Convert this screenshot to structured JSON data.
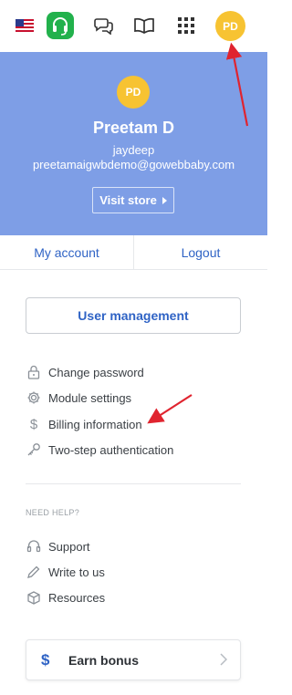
{
  "topbar": {
    "icons": {
      "flag": "us-flag-icon",
      "support": "headset-icon",
      "chat": "chat-bubbles-icon",
      "docs": "open-book-icon",
      "apps": "apps-grid-icon"
    },
    "avatar_initials": "PD"
  },
  "profile": {
    "avatar_initials": "PD",
    "name": "Preetam D",
    "username": "jaydeep",
    "email": "preetamaigwbdemo@gowebbaby.com",
    "visit_store_label": "Visit store"
  },
  "account_links": {
    "my_account": "My account",
    "logout": "Logout"
  },
  "user_management_label": "User management",
  "settings_menu": [
    {
      "label": "Change password",
      "icon": "lock-icon"
    },
    {
      "label": "Module settings",
      "icon": "gear-icon"
    },
    {
      "label": "Billing information",
      "icon": "dollar-icon"
    },
    {
      "label": "Two-step authentication",
      "icon": "key-icon"
    }
  ],
  "help": {
    "heading": "NEED HELP?",
    "items": [
      {
        "label": "Support",
        "icon": "headset-icon"
      },
      {
        "label": "Write to us",
        "icon": "pencil-icon"
      },
      {
        "label": "Resources",
        "icon": "box-icon"
      }
    ]
  },
  "earn_bonus": {
    "label": "Earn bonus",
    "icon": "$"
  },
  "colors": {
    "profile_bg": "#7e9ee6",
    "avatar": "#f7c332",
    "link_blue": "#2f63c5",
    "annotation_red": "#e0242f",
    "support_green": "#22b14c"
  }
}
